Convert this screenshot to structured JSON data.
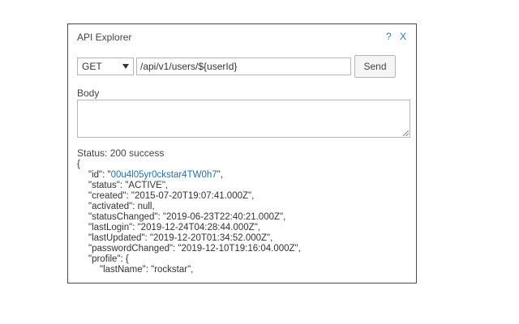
{
  "dialog": {
    "title": "API Explorer",
    "help_label": "?",
    "close_label": "X"
  },
  "request": {
    "method": "GET",
    "url": "/api/v1/users/${userId}",
    "send_label": "Send"
  },
  "body": {
    "label": "Body",
    "value": ""
  },
  "response": {
    "status": "Status: 200 success",
    "open_brace": "{",
    "id_key": "\"id\": \"",
    "id_value": "00u4l05yr0ckstar4TW0h7",
    "id_tail": "\",",
    "lines": [
      "\"status\": \"ACTIVE\",",
      "\"created\": \"2015-07-20T19:07:41.000Z\",",
      "\"activated\": null,",
      "\"statusChanged\": \"2019-06-23T22:40:21.000Z\",",
      "\"lastLogin\": \"2019-12-24T04:28:44.000Z\",",
      "\"lastUpdated\": \"2019-12-20T01:34:52.000Z\",",
      "\"passwordChanged\": \"2019-12-10T19:16:04.000Z\",",
      "\"profile\": {"
    ],
    "nested_line": "\"lastName\": \"rockstar\","
  }
}
